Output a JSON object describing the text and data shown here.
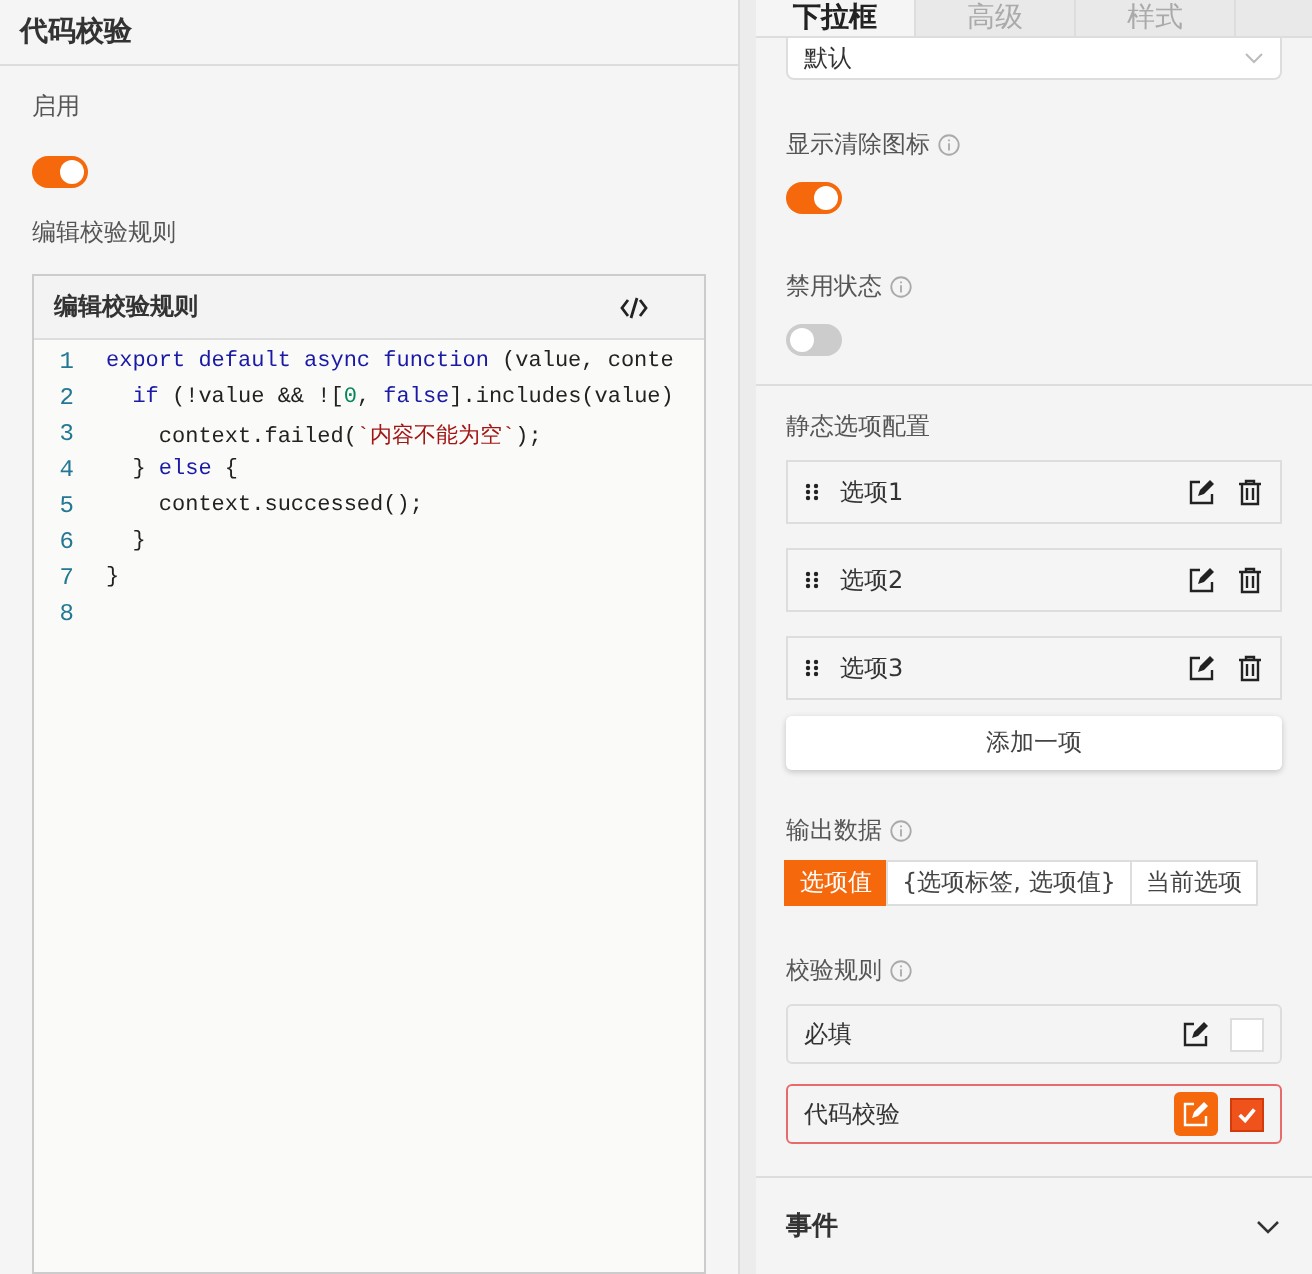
{
  "left_panel": {
    "title": "代码校验",
    "enable": {
      "label": "启用",
      "on": true
    },
    "editor_label": "编辑校验规则",
    "editor": {
      "title": "编辑校验规则",
      "lines": [
        {
          "number": "1",
          "tokens": [
            {
              "kind": "keyword",
              "text": "export default async function"
            },
            {
              "kind": "plain",
              "text": " (value, conte"
            }
          ]
        },
        {
          "number": "2",
          "tokens": [
            {
              "kind": "keyword",
              "text": "  if"
            },
            {
              "kind": "plain",
              "text": " (!value && !["
            },
            {
              "kind": "number",
              "text": "0"
            },
            {
              "kind": "plain",
              "text": ", "
            },
            {
              "kind": "keyword",
              "text": "false"
            },
            {
              "kind": "plain",
              "text": "].includes(value)"
            }
          ]
        },
        {
          "number": "3",
          "tokens": [
            {
              "kind": "plain",
              "text": "    context.failed("
            },
            {
              "kind": "string",
              "text": "`内容不能为空`"
            },
            {
              "kind": "plain",
              "text": ");"
            }
          ]
        },
        {
          "number": "4",
          "tokens": [
            {
              "kind": "plain",
              "text": "  } "
            },
            {
              "kind": "keyword",
              "text": "else"
            },
            {
              "kind": "plain",
              "text": " {"
            }
          ]
        },
        {
          "number": "5",
          "tokens": [
            {
              "kind": "plain",
              "text": "    context.successed();"
            }
          ]
        },
        {
          "number": "6",
          "tokens": [
            {
              "kind": "plain",
              "text": "  }"
            }
          ]
        },
        {
          "number": "7",
          "tokens": [
            {
              "kind": "plain",
              "text": "}"
            }
          ]
        },
        {
          "number": "8"
        }
      ]
    }
  },
  "right_panel": {
    "tabs": [
      {
        "label": "下拉框",
        "selected": true
      },
      {
        "label": "高级",
        "selected": false
      },
      {
        "label": "样式",
        "selected": false
      }
    ],
    "select": {
      "value": "默认"
    },
    "switches": [
      {
        "label": "显示清除图标",
        "on": true
      },
      {
        "label": "禁用状态",
        "on": false
      }
    ],
    "static_options": {
      "label": "静态选项配置",
      "items": [
        "选项1",
        "选项2",
        "选项3"
      ],
      "add_button": "添加一项"
    },
    "output": {
      "label": "输出数据",
      "options": [
        {
          "label": "选项值",
          "selected": true
        },
        {
          "label": "{选项标签, 选项值}",
          "selected": false
        },
        {
          "label": "当前选项",
          "selected": false
        }
      ]
    },
    "rules": {
      "label": "校验规则",
      "items": [
        {
          "label": "必填",
          "checked": false
        },
        {
          "label": "代码校验",
          "checked": true
        }
      ]
    },
    "events": {
      "label": "事件",
      "expanded": false
    }
  }
}
